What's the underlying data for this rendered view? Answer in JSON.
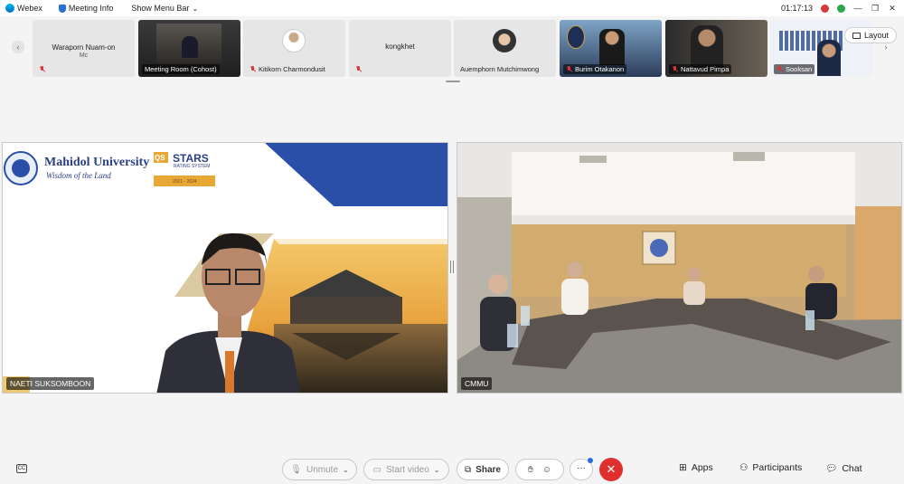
{
  "topbar": {
    "app": "Webex",
    "meeting_info": "Meeting Info",
    "show_menu_bar": "Show Menu Bar",
    "timer": "01:17:13"
  },
  "participants": [
    {
      "name": "Waraporn Nuam-on",
      "sub": "Mc",
      "muted": true
    },
    {
      "name": "Meeting Room (Cohost)",
      "muted": false
    },
    {
      "name": "Kitikorn Charmondusit",
      "muted": true
    },
    {
      "name": "kongkhet",
      "muted": true
    },
    {
      "name": "Auemphorn Mutchimwong",
      "muted": false
    },
    {
      "name": "Burim Otakanon",
      "muted": true
    },
    {
      "name": "Nattavud Pimpa",
      "muted": true
    },
    {
      "name": "Sooksan",
      "muted": true
    }
  ],
  "layout_label": "Layout",
  "stage": {
    "left_name": "NAETI SUKSOMBOON",
    "right_name": "CMMU",
    "banner": {
      "university": "Mahidol University",
      "tagline": "Wisdom of the Land",
      "qs": "QS",
      "stars": "STARS",
      "rating": "RATING SYSTEM",
      "years": "2021 - 2024"
    }
  },
  "controls": {
    "unmute": "Unmute",
    "start_video": "Start video",
    "share": "Share",
    "more": "···",
    "apps": "Apps",
    "participants": "Participants",
    "chat": "Chat"
  },
  "colors": {
    "end_call": "#e02f2f",
    "accent": "#2a6fd6"
  }
}
